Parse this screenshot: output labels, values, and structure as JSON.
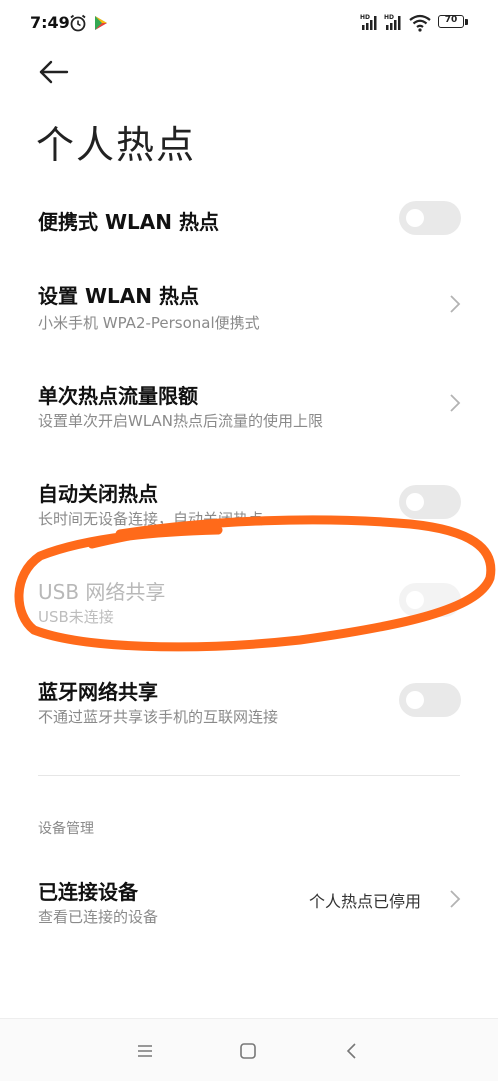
{
  "status_bar": {
    "time": "7:49",
    "battery": "70",
    "icons": [
      "alarm-icon",
      "play-store-icon",
      "hd-signal-icon",
      "hd-signal-icon",
      "wifi-icon",
      "battery-icon"
    ]
  },
  "header": {
    "back_icon": "arrow-left-icon",
    "title": "个人热点"
  },
  "settings": {
    "portable_wlan": {
      "title": "便携式 WLAN 热点",
      "enabled": false
    },
    "setup_wlan": {
      "title": "设置 WLAN 热点",
      "subtitle": "小米手机 WPA2-Personal便携式"
    },
    "data_limit": {
      "title": "单次热点流量限额",
      "subtitle": "设置单次开启WLAN热点后流量的使用上限"
    },
    "auto_off": {
      "title": "自动关闭热点",
      "subtitle": "长时间无设备连接，自动关闭热点",
      "enabled": false
    },
    "usb_tethering": {
      "title": "USB 网络共享",
      "subtitle": "USB未连接",
      "enabled": false,
      "disabled": true
    },
    "bt_tethering": {
      "title": "蓝牙网络共享",
      "subtitle": "不通过蓝牙共享该手机的互联网连接",
      "enabled": false
    }
  },
  "device_section": {
    "header": "设备管理",
    "connected": {
      "title": "已连接设备",
      "subtitle": "查看已连接的设备",
      "value": "个人热点已停用"
    }
  },
  "colors": {
    "annotation": "#ff6a1a",
    "toggle_off": "#e9e9e9",
    "secondary_text": "#8a8a8a"
  }
}
